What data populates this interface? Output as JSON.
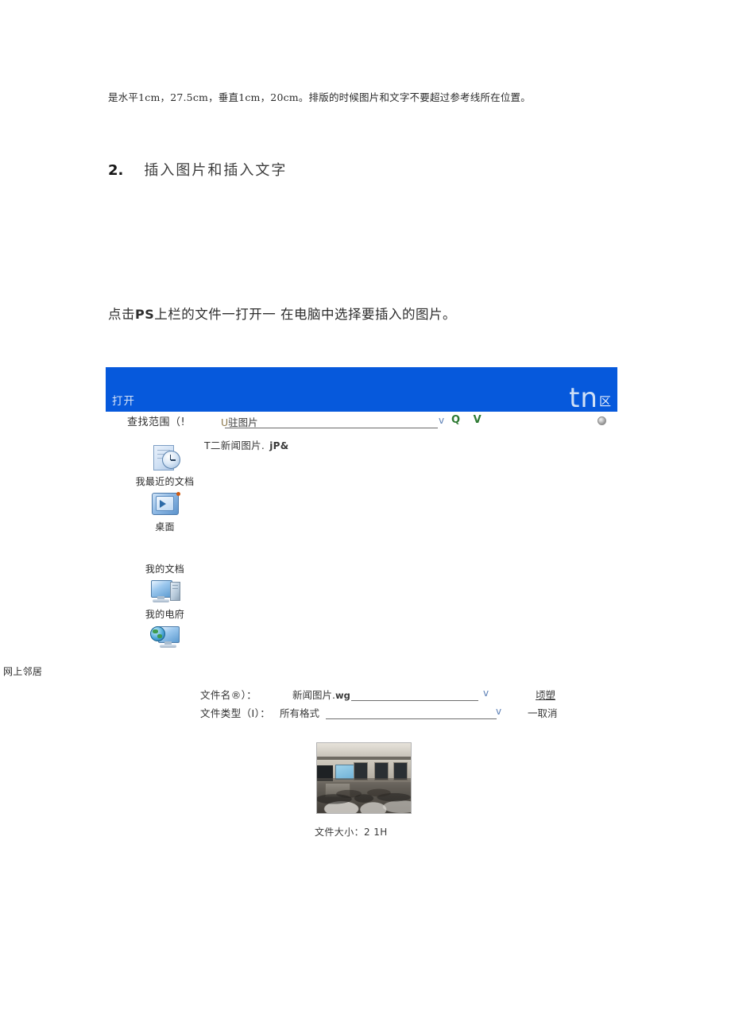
{
  "document": {
    "intro_paragraph": "是水平1cm，27.5cm，垂直1cm，20cm。排版的时候图片和文字不要超过参考线所在位置。",
    "heading": {
      "number": "2.",
      "text": "插入图片和插入文字"
    },
    "step_text_before": "点击",
    "step_text_bold": "PS",
    "step_text_after": "上栏的文件一打开一  在电脑中选择要插入的图片。"
  },
  "dialog": {
    "title": "打开",
    "corner_mark": "tn",
    "corner_suffix": "区",
    "titlebar_color": "#0659dc",
    "lookin": {
      "label": "查找范围（!",
      "value_prefix": "U",
      "value": "驻图片",
      "caret": "v",
      "toolbar_icons": "Q V"
    },
    "file_list": [
      {
        "name": "T二新闻图片.",
        "ext": "jP&"
      }
    ],
    "places": [
      {
        "label": "我最近的文档",
        "icon": "recent-documents-icon"
      },
      {
        "label": "桌面",
        "icon": "desktop-icon"
      },
      {
        "label": "我的文档",
        "icon": "my-documents-icon"
      },
      {
        "label": "我的电府",
        "icon": "my-computer-icon"
      },
      {
        "label": "网上邻居",
        "icon": "network-places-icon"
      }
    ],
    "fields": {
      "filename": {
        "label": "文件名®）：",
        "value": "新闻图片.",
        "value_suffix": "wg",
        "caret": "v",
        "button": "顷塑"
      },
      "filetype": {
        "label": "文件类型（I）：",
        "value": "所有格式",
        "caret": "v",
        "button": "一取消"
      }
    },
    "preview": {
      "image_alt": "classroom-lecture-photo",
      "filesize_label": "文件大小：2 1H"
    }
  }
}
